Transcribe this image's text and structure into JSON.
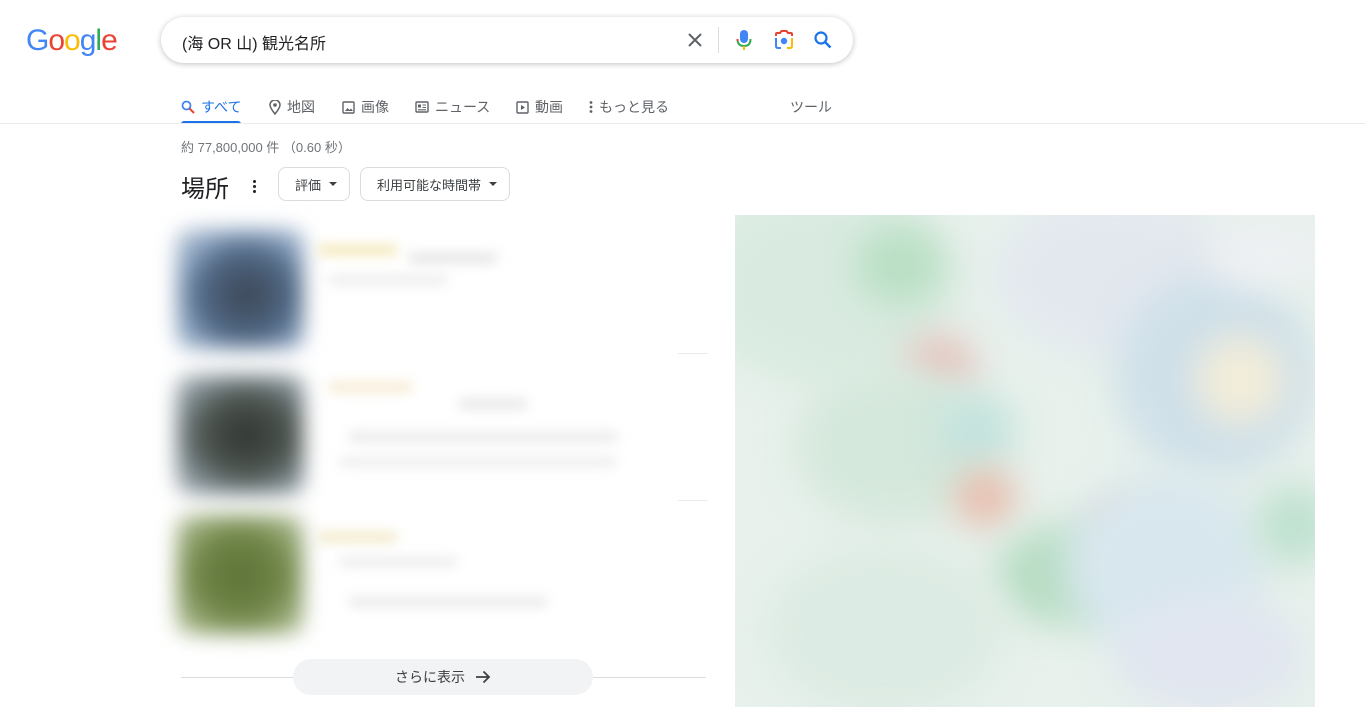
{
  "logo": {
    "letters": [
      "G",
      "o",
      "o",
      "g",
      "l",
      "e"
    ],
    "colors": [
      "#4285f4",
      "#ea4335",
      "#fbbc05",
      "#4285f4",
      "#34a853",
      "#ea4335"
    ]
  },
  "search": {
    "query": "(海 OR 山) 観光名所"
  },
  "tabs": [
    {
      "label": "すべて",
      "icon": "search-icon",
      "active": true
    },
    {
      "label": "地図",
      "icon": "map-pin-icon"
    },
    {
      "label": "画像",
      "icon": "image-icon"
    },
    {
      "label": "ニュース",
      "icon": "news-icon"
    },
    {
      "label": "動画",
      "icon": "video-icon"
    },
    {
      "label": "もっと見る",
      "icon": "more-vert-icon"
    }
  ],
  "tools_label": "ツール",
  "result_stats": "約 77,800,000 件 （0.60 秒）",
  "places": {
    "title": "場所",
    "filters": [
      {
        "label": "評価"
      },
      {
        "label": "利用可能な時間帯"
      }
    ],
    "more_label": "さらに表示"
  },
  "colors": {
    "accent": "#1a73e8",
    "text_secondary": "#5f6368"
  }
}
